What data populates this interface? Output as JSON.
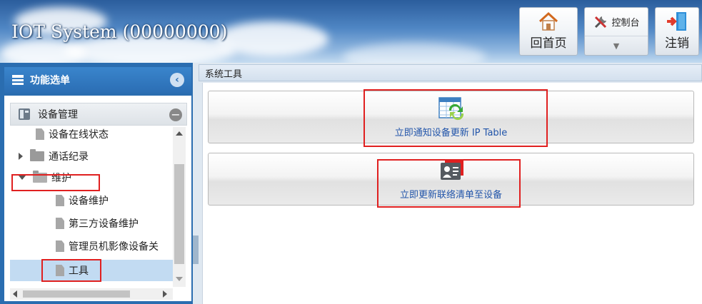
{
  "header": {
    "app_title": "IOT System (00000000)",
    "home_label": "回首页",
    "console_label": "控制台",
    "logout_label": "注销"
  },
  "sidebar": {
    "title": "功能选单",
    "group_title": "设备管理",
    "tree_items": [
      {
        "label": "设备在线状态",
        "icon": "document-icon"
      },
      {
        "label": "通话纪录",
        "icon": "folder-icon",
        "state": "collapsed"
      },
      {
        "label": "维护",
        "icon": "folder-icon",
        "state": "expanded"
      },
      {
        "label": "设备维护",
        "icon": "document-icon"
      },
      {
        "label": "第三方设备维护",
        "icon": "document-icon"
      },
      {
        "label": "管理员机影像设备关",
        "icon": "document-icon"
      },
      {
        "label": "工具",
        "icon": "document-icon",
        "selected": true
      }
    ]
  },
  "main": {
    "breadcrumb": "系统工具",
    "tools": [
      {
        "label": "立即通知设备更新 IP Table",
        "icon": "table-refresh-icon"
      },
      {
        "label": "立即更新联络清单至设备",
        "icon": "contact-card-icon"
      }
    ]
  },
  "colors": {
    "highlight_box": "#e02020",
    "link_text": "#2255aa",
    "sidebar_blue": "#2a6db0",
    "selected_row": "#c2dbf2"
  }
}
